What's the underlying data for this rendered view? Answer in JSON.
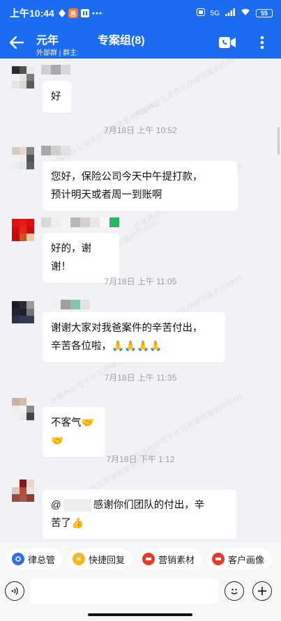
{
  "status_bar": {
    "time": "上午10:44",
    "left_icons": [
      "location-icon",
      "app-badge-icon",
      "bars-app-icon",
      "more-dots-icon"
    ],
    "app_badge": "邑",
    "network": "5G",
    "battery": "55"
  },
  "header": {
    "owner": "元年",
    "meta": "外部群 | 群主:",
    "title": "专案组(8)"
  },
  "messages": [
    {
      "text": "好"
    },
    {
      "time": "7月18日  上午 10:52"
    },
    {
      "text_line1": "您好，保险公司今天中午提打款，",
      "text_line2": "预计明天或者周一到账啊"
    },
    {
      "text": "好的，谢谢！"
    },
    {
      "time": "7月18日  上午 11:05"
    },
    {
      "text_line1": "谢谢大家对我爸案件的辛苦付出，",
      "text_line2": "辛苦各位啦，",
      "emoji": "🙏🙏🙏🙏"
    },
    {
      "time": "7月18日  上午 11:35"
    },
    {
      "text": "不客气",
      "emoji": "🤝🤝"
    },
    {
      "time": "7月18日  下午 1:12"
    },
    {
      "mention": "@",
      "text_line1": "感谢你们团队的付出，辛",
      "text_line2": "苦了",
      "emoji": "👍"
    }
  ],
  "watermark": "许瑞林@北京市元甲律师事务所6995",
  "quick_actions": [
    {
      "label": "律总管",
      "icon": "shield-icon",
      "color": "#2f6fe8"
    },
    {
      "label": "快捷回复",
      "icon": "lightning-icon",
      "color": "#f2b81f"
    },
    {
      "label": "营销素材",
      "icon": "marketing-icon",
      "color": "#e8392d"
    },
    {
      "label": "客户画像",
      "icon": "portrait-icon",
      "color": "#e8392d"
    }
  ],
  "input": {
    "placeholder": ""
  },
  "colors": {
    "primary": "#1c6cf2",
    "background": "#f1f2f6",
    "bubble": "#ffffff"
  }
}
